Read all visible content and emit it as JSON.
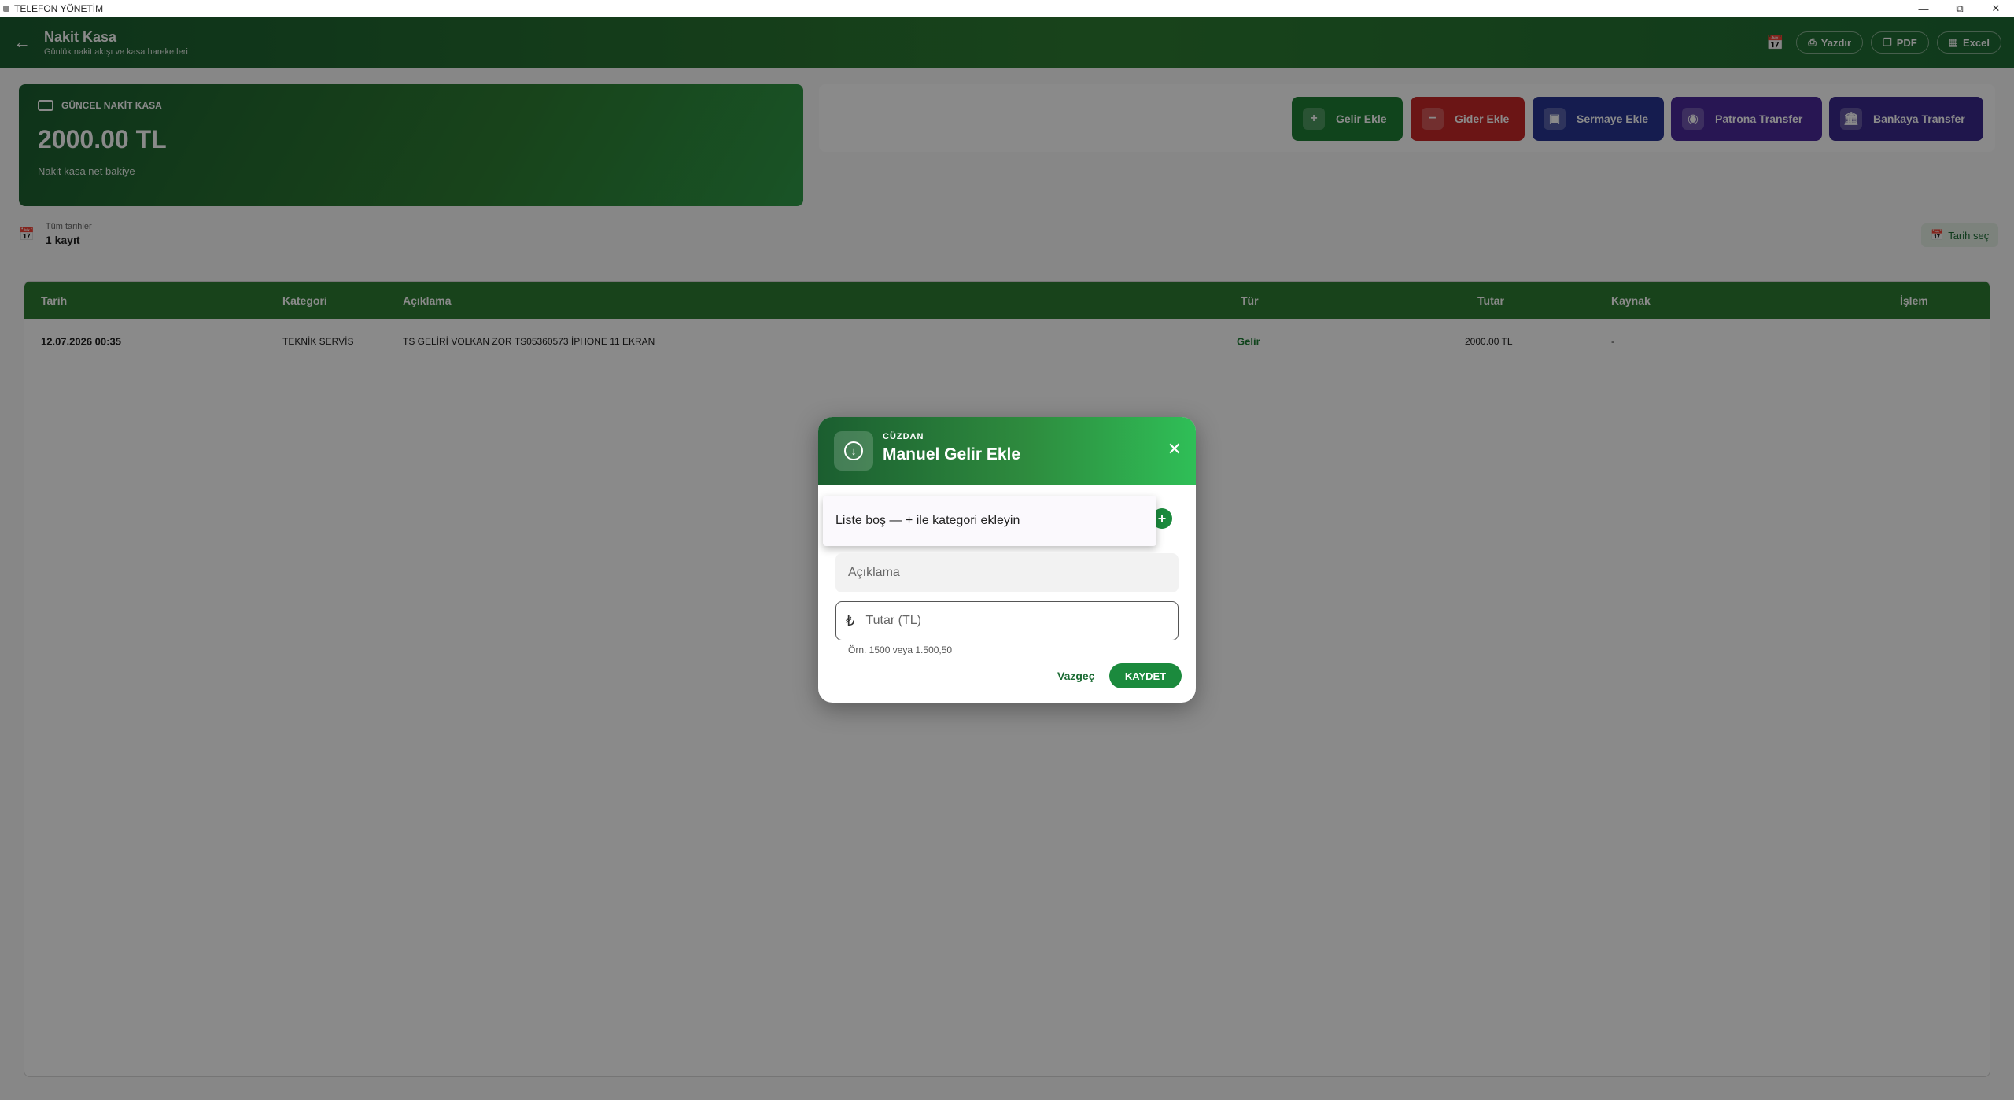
{
  "window": {
    "title": "TELEFON YÖNETİM"
  },
  "header": {
    "title": "Nakit Kasa",
    "subtitle": "Günlük nakit akışı ve kasa hareketleri",
    "print_label": "Yazdır",
    "pdf_label": "PDF",
    "excel_label": "Excel"
  },
  "cash": {
    "label": "GÜNCEL NAKİT KASA",
    "amount": "2000.00 TL",
    "sub": "Nakit kasa net bakiye"
  },
  "actions": {
    "income": "Gelir Ekle",
    "expense": "Gider Ekle",
    "capital": "Sermaye Ekle",
    "boss_transfer": "Patrona Transfer",
    "bank_transfer": "Bankaya Transfer"
  },
  "filter": {
    "range": "Tüm tarihler",
    "count": "1 kayıt",
    "date_button": "Tarih seç"
  },
  "table": {
    "columns": {
      "date": "Tarih",
      "category": "Kategori",
      "description": "Açıklama",
      "type": "Tür",
      "amount": "Tutar",
      "source": "Kaynak",
      "action": "İşlem"
    },
    "rows": [
      {
        "date": "12.07.2026 00:35",
        "category": "TEKNİK SERVİS",
        "description": "TS GELİRİ VOLKAN ZOR TS05360573 İPHONE 11 EKRAN",
        "type": "Gelir",
        "amount": "2000.00 TL",
        "source": "-"
      }
    ]
  },
  "dialog": {
    "kicker": "CÜZDAN",
    "title": "Manuel Gelir Ekle",
    "dropdown_empty": "Liste boş — + ile kategori ekleyin",
    "description_placeholder": "Açıklama",
    "amount_placeholder": "Tutar (TL)",
    "amount_hint": "Örn. 1500 veya 1.500,50",
    "cancel": "Vazgeç",
    "save": "KAYDET"
  },
  "colors": {
    "primary": "#2e7d32",
    "income": "#1e7e34",
    "expense": "#c62828",
    "capital": "#283593",
    "boss": "#4a2a9a",
    "bank": "#3a2a8c"
  }
}
